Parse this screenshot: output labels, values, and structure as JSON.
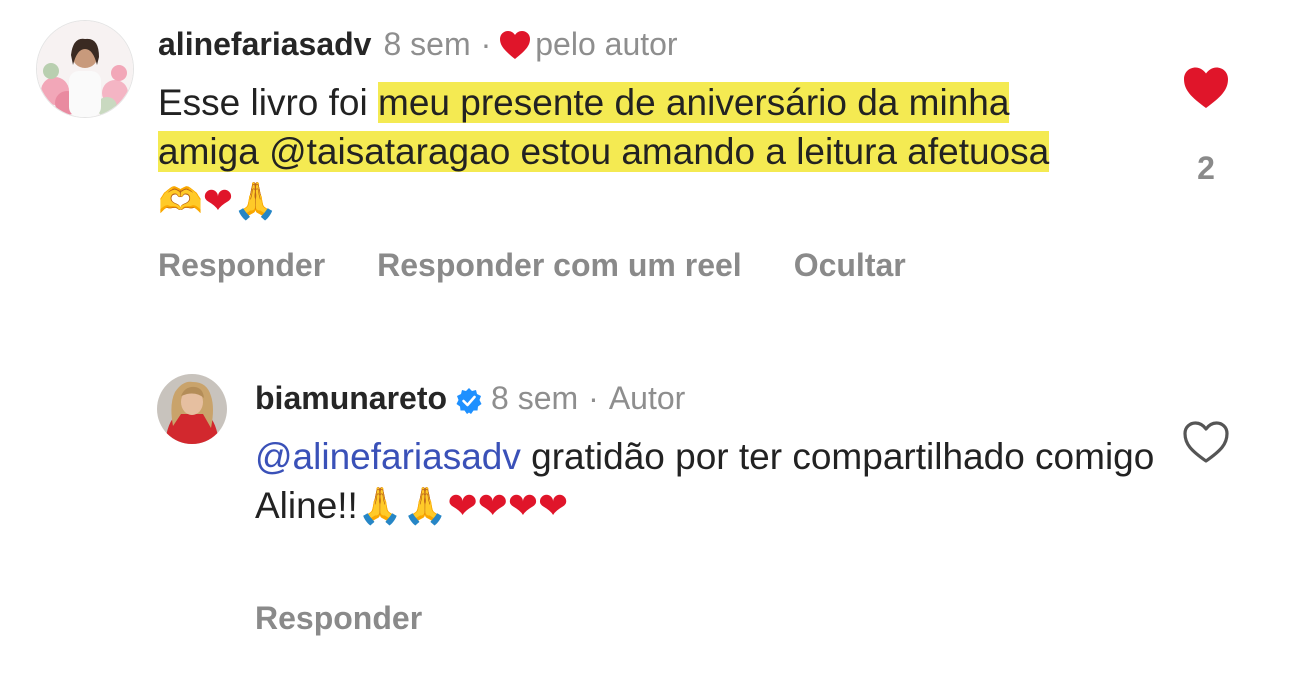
{
  "comments": [
    {
      "username": "alinefariasadv",
      "time": "8 sem",
      "separator": "·",
      "author_badge": "pelo autor",
      "text_plain": "Esse livro foi ",
      "text_hl1": "meu presente de aniversário da minha amiga ",
      "mention": "@taisataragao",
      "text_hl2": "  estou amando a leitura afetuosa",
      "emojis": [
        "🫶",
        "❤",
        "🙏"
      ],
      "actions": [
        "Responder",
        "Responder com um reel",
        "Ocultar"
      ],
      "liked": true,
      "like_count": "2",
      "avatar_icon": "avatar-photo-flowers"
    },
    {
      "username": "biamunareto",
      "verified_icon": "verified-badge-icon",
      "time": "8 sem",
      "separator": "·",
      "author_label": "Autor",
      "mention": "@alinefariasadv",
      "text": " gratidão por ter compartilhado comigo Aline!!",
      "emojis": [
        "🙏",
        "🙏",
        "❤",
        "❤",
        "❤",
        "❤"
      ],
      "actions": [
        "Responder"
      ],
      "liked": false,
      "avatar_icon": "avatar-photo-woman"
    }
  ],
  "colors": {
    "highlight": "#f4ea52",
    "heart_red": "#e0152a",
    "mention_blue": "#3a51b8",
    "verified_blue": "#1e90ff",
    "muted_gray": "#8e8e8e"
  }
}
